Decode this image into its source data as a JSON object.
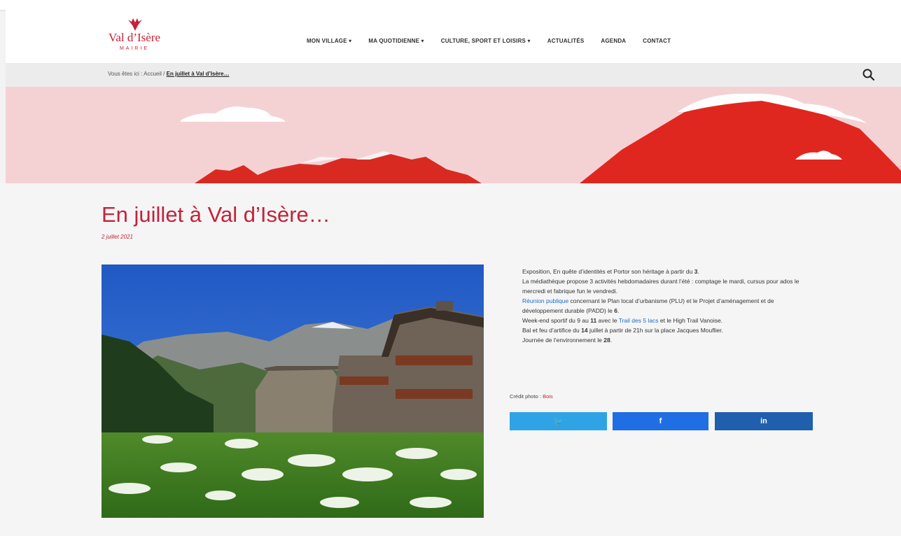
{
  "header": {
    "logo": {
      "text": "Val d’Isère",
      "sub": "MAIRIE"
    },
    "nav": [
      {
        "label": "MON VILLAGE ▾"
      },
      {
        "label": "MA QUOTIDIENNE ▾"
      },
      {
        "label": "CULTURE, SPORT ET LOISIRS ▾"
      },
      {
        "label": "ACTUALITÉS"
      },
      {
        "label": "AGENDA"
      },
      {
        "label": "CONTACT"
      }
    ]
  },
  "breadcrumb": {
    "prefix": "Vous êtes ici :",
    "home": "Accueil",
    "separator": "/",
    "current": "En juillet à Val d’Isère…"
  },
  "article": {
    "title": "En juillet à Val d’Isère…",
    "date": "2 juillet 2021",
    "paragraphs": [
      {
        "segments": [
          {
            "text": "Exposition, En quête d’identités et Portor son héritage à partir du ",
            "bold": false,
            "link": false
          },
          {
            "text": "3",
            "bold": true,
            "link": false
          },
          {
            "text": ".",
            "bold": false,
            "link": false
          }
        ]
      },
      {
        "segments": [
          {
            "text": "La médiathèque propose 3 activités hebdomadaires durant l’été : comptage le mardi, cursus pour ados le mercredi et fabrique fun le vendredi.",
            "bold": false,
            "link": false
          }
        ]
      },
      {
        "segments": [
          {
            "text": "Réunion publique",
            "bold": false,
            "link": true
          },
          {
            "text": " concernant le Plan local d’urbanisme (PLU) et le Projet d’aménagement et de développement durable (PADD) le ",
            "bold": false,
            "link": false
          },
          {
            "text": "6",
            "bold": true,
            "link": false
          },
          {
            "text": ".",
            "bold": false,
            "link": false
          }
        ]
      },
      {
        "segments": [
          {
            "text": "Week-end sportif du 9 au ",
            "bold": false,
            "link": false
          },
          {
            "text": "11",
            "bold": true,
            "link": false
          },
          {
            "text": " avec le ",
            "bold": false,
            "link": false
          },
          {
            "text": "Trail des 5 lacs",
            "bold": false,
            "link": true
          },
          {
            "text": " et le High Trail Vanoise.",
            "bold": false,
            "link": false
          }
        ]
      },
      {
        "segments": [
          {
            "text": "Bal et feu d’artifice du ",
            "bold": false,
            "link": false
          },
          {
            "text": "14",
            "bold": true,
            "link": false
          },
          {
            "text": " juillet à partir de 21h sur la place Jacques Mouflier.",
            "bold": false,
            "link": false
          }
        ]
      },
      {
        "segments": [
          {
            "text": "Journée de l’environnement le ",
            "bold": false,
            "link": false
          },
          {
            "text": "28",
            "bold": true,
            "link": false
          },
          {
            "text": ".",
            "bold": false,
            "link": false
          }
        ]
      }
    ],
    "credit": {
      "label": "Crédit photo :",
      "name": "Bois"
    },
    "share": {
      "twitter": {
        "icon": "twitter-icon",
        "glyph": "🐦",
        "color": "#2ea4e6"
      },
      "facebook": {
        "icon": "facebook-icon",
        "glyph": "f",
        "color": "#1f6ee3"
      },
      "linkedin": {
        "icon": "linkedin-icon",
        "glyph": "in",
        "color": "#1f5fad"
      }
    }
  },
  "colors": {
    "brand": "#c0243a",
    "link": "#1c6fc4"
  }
}
